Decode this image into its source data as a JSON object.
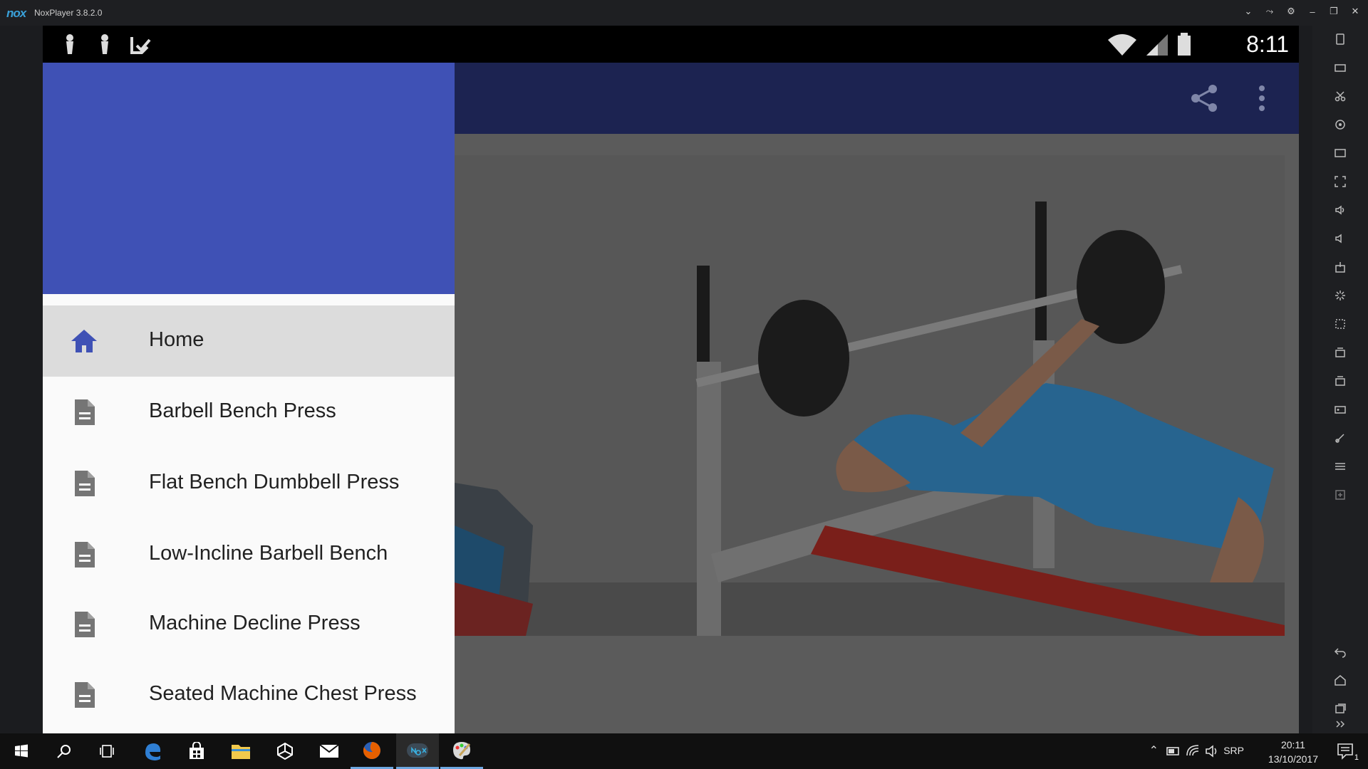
{
  "window": {
    "logo": "nox",
    "title": "NoxPlayer 3.8.2.0"
  },
  "status_bar": {
    "time": "8:11"
  },
  "drawer": {
    "items": [
      {
        "label": "Home",
        "icon": "home-icon",
        "active": true
      },
      {
        "label": "Barbell Bench Press",
        "icon": "document-icon"
      },
      {
        "label": "Flat Bench Dumbbell Press",
        "icon": "document-icon"
      },
      {
        "label": "Low-Incline Barbell Bench",
        "icon": "document-icon"
      },
      {
        "label": "Machine Decline Press",
        "icon": "document-icon"
      },
      {
        "label": "Seated Machine Chest Press",
        "icon": "document-icon"
      }
    ]
  },
  "colors": {
    "drawer_header": "#3f51b5",
    "app_bar": "#1c2351",
    "accent": "#3f51b5"
  },
  "taskbar": {
    "language": "SRP",
    "time": "20:11",
    "date": "13/10/2017",
    "notification_count": "1"
  }
}
